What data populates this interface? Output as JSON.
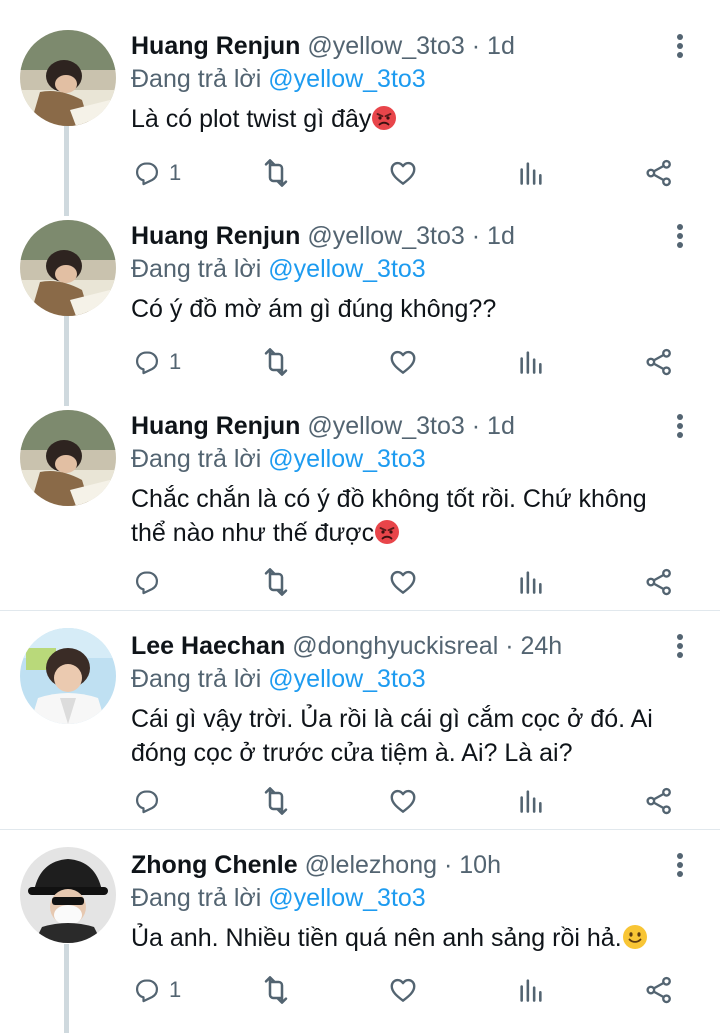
{
  "reply_prefix": "Đang trả lời",
  "icons": {
    "reply": "reply-icon",
    "retweet": "retweet-icon",
    "like": "heart-icon",
    "analytics": "analytics-icon",
    "share": "share-icon",
    "more": "more-vertical-icon"
  },
  "colors": {
    "text": "#0f1419",
    "muted": "#536471",
    "link": "#1d9bf0",
    "thread_line": "#cfd9de"
  },
  "tweets": [
    {
      "name": "Huang Renjun",
      "handle": "@yellow_3to3",
      "dot": "·",
      "time": "1d",
      "reply_to": "@yellow_3to3",
      "lines": [
        "Là có plot twist gì đây"
      ],
      "emoji": "pouting-face",
      "reply_count": "1"
    },
    {
      "name": "Huang Renjun",
      "handle": "@yellow_3to3",
      "dot": "·",
      "time": "1d",
      "reply_to": "@yellow_3to3",
      "lines": [
        "Có ý đồ mờ ám gì đúng không??"
      ],
      "reply_count": "1"
    },
    {
      "name": "Huang Renjun",
      "handle": "@yellow_3to3",
      "dot": "·",
      "time": "1d",
      "reply_to": "@yellow_3to3",
      "lines": [
        "Chắc chắn là có ý đồ không tốt rồi. Chứ không",
        "thể nào như thế được"
      ],
      "emoji": "pouting-face",
      "reply_count": ""
    },
    {
      "name": "Lee Haechan",
      "handle": "@donghyuckisreal",
      "dot": "·",
      "time": "24h",
      "reply_to": "@yellow_3to3",
      "lines": [
        "Cái gì vậy trời. Ủa rồi là cái gì cắm cọc ở đó. Ai",
        "đóng cọc ở trước cửa tiệm à. Ai? Là ai?"
      ],
      "reply_count": ""
    },
    {
      "name": "Zhong Chenle",
      "handle": "@lelezhong",
      "dot": "·",
      "time": "10h",
      "reply_to": "@yellow_3to3",
      "lines": [
        "Ủa anh. Nhiều tiền quá nên anh sảng rồi hả."
      ],
      "emoji": "slightly-smiling-face",
      "reply_count": "1"
    }
  ]
}
